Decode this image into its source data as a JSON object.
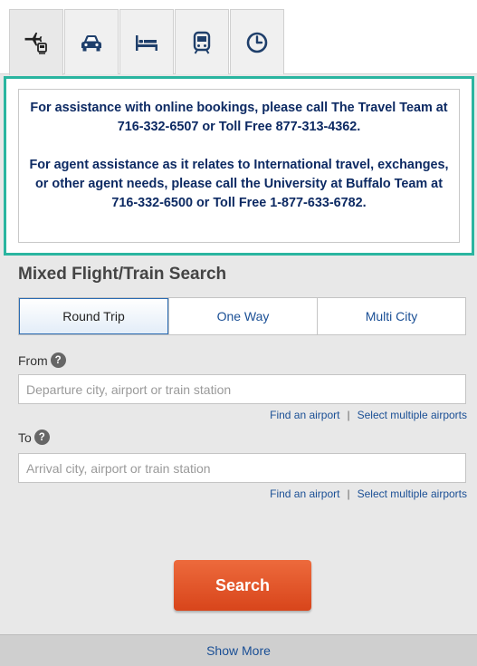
{
  "tabs": [
    {
      "icon": "flight-train-icon",
      "active": true
    },
    {
      "icon": "car-icon",
      "active": false
    },
    {
      "icon": "hotel-bed-icon",
      "active": false
    },
    {
      "icon": "train-icon",
      "active": false
    },
    {
      "icon": "clock-icon",
      "active": false
    }
  ],
  "notice": {
    "paragraph_1": "For assistance with online bookings, please call The Travel Team at 716-332-6507 or Toll Free 877-313-4362.",
    "paragraph_2": "For agent assistance as it relates to International travel, exchanges, or other agent needs, please call the University at Buffalo Team at 716-332-6500 or Toll Free 1-877-633-6782."
  },
  "search_form": {
    "title": "Mixed Flight/Train Search",
    "trip_types": [
      {
        "label": "Round Trip",
        "selected": true
      },
      {
        "label": "One Way",
        "selected": false
      },
      {
        "label": "Multi City",
        "selected": false
      }
    ],
    "from": {
      "label": "From",
      "placeholder": "Departure city, airport or train station",
      "value": "",
      "link_find": "Find an airport",
      "link_separator": "|",
      "link_multiple": "Select multiple airports"
    },
    "to": {
      "label": "To",
      "placeholder": "Arrival city, airport or train station",
      "value": "",
      "link_find": "Find an airport",
      "link_separator": "|",
      "link_multiple": "Select multiple airports"
    },
    "help_glyph": "?",
    "search_label": "Search",
    "show_more_label": "Show More"
  },
  "colors": {
    "notice_border": "#2ab5a0",
    "notice_text": "#0d2a63",
    "link": "#1a4f95",
    "search_button": "#e05a2b",
    "panel_background": "#e8e8e8"
  }
}
